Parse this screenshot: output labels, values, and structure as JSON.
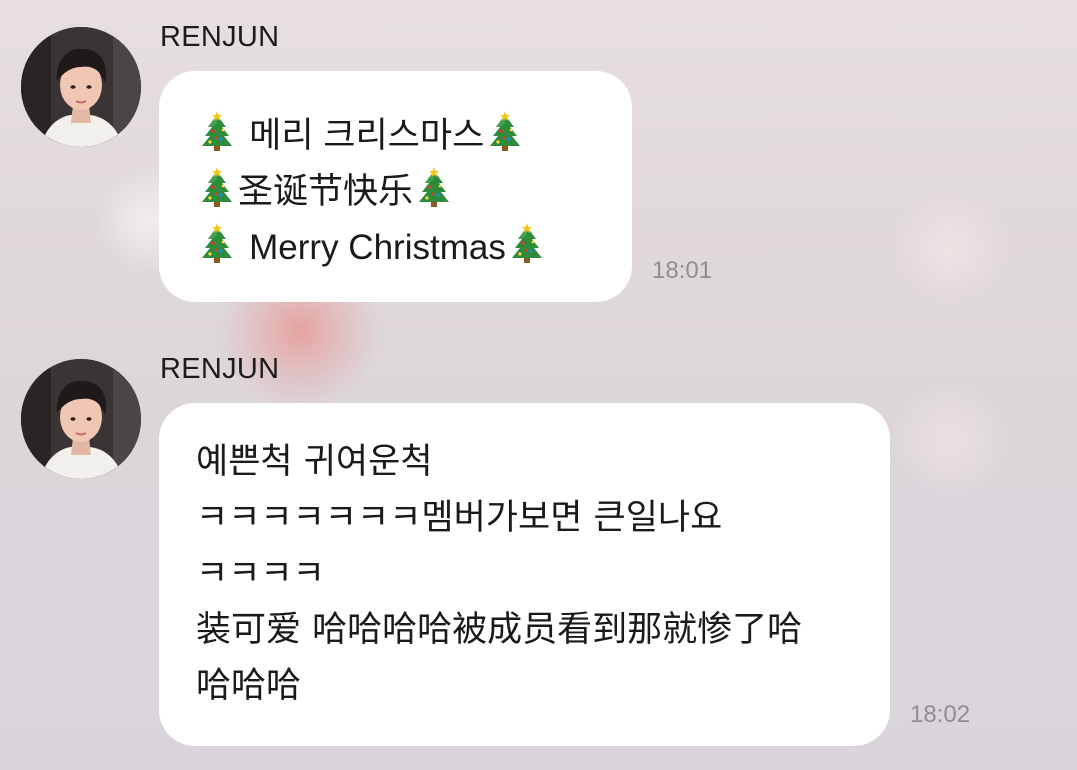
{
  "messages": [
    {
      "sender": "RENJUN",
      "time": "18:01",
      "lines": [
        "메리 크리스마스",
        "圣诞节快乐",
        "Merry Christmas"
      ],
      "emoji": "christmas-tree-icon"
    },
    {
      "sender": "RENJUN",
      "time": "18:02",
      "lines": [
        "예쁜척 귀여운척",
        "ㅋㅋㅋㅋㅋㅋㅋ멤버가보면 큰일나요",
        "ㅋㅋㅋㅋ",
        "装可爱 哈哈哈哈被成员看到那就惨了哈",
        "哈哈哈"
      ]
    }
  ],
  "colors": {
    "bubble": "#ffffff",
    "timestamp": "#8e8e93",
    "text": "#1a1a1a"
  }
}
